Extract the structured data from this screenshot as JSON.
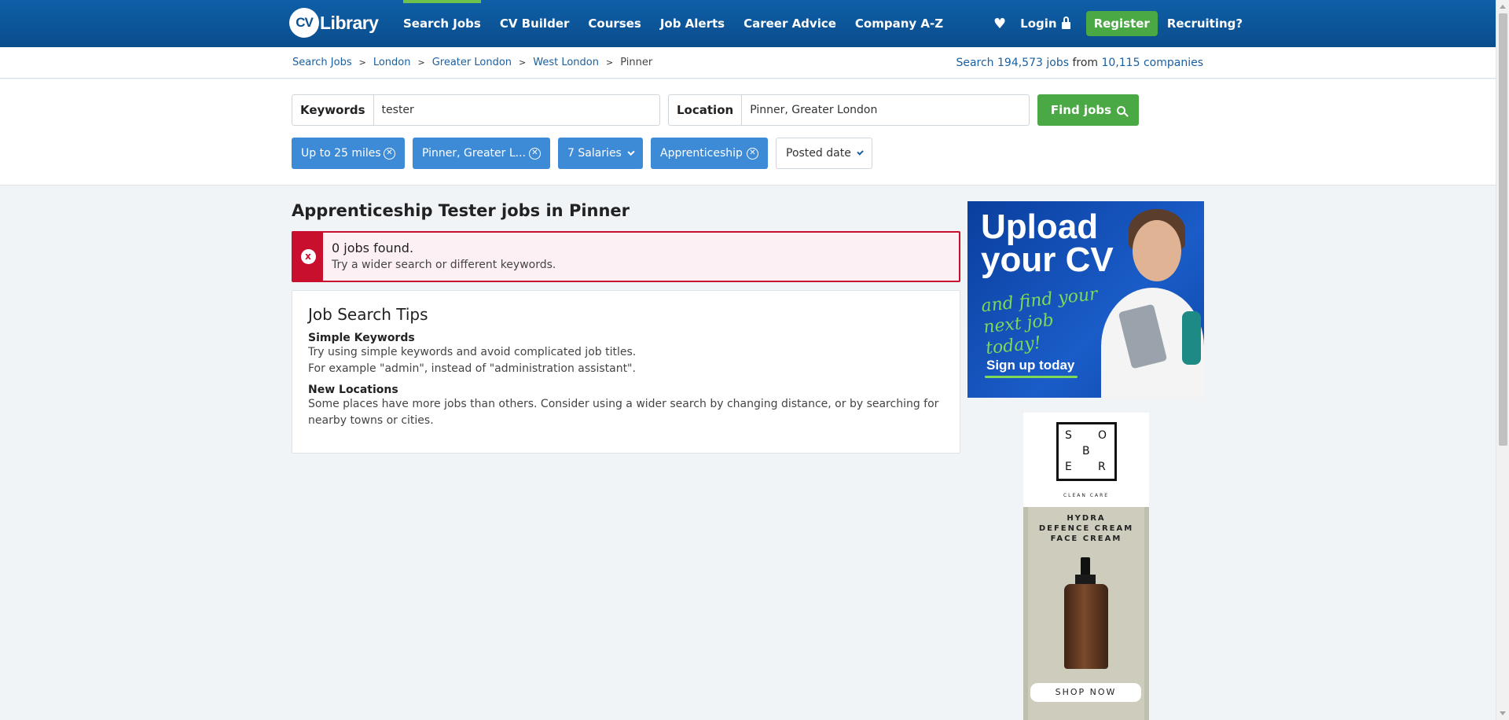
{
  "header": {
    "logo_cv": "CV",
    "logo_library": "Library",
    "nav": [
      {
        "label": "Search Jobs"
      },
      {
        "label": "CV Builder"
      },
      {
        "label": "Courses"
      },
      {
        "label": "Job Alerts"
      },
      {
        "label": "Career Advice"
      },
      {
        "label": "Company A-Z"
      }
    ],
    "login_label": "Login",
    "register_label": "Register",
    "recruiting_label": "Recruiting?"
  },
  "breadcrumb": {
    "items": [
      "Search Jobs",
      "London",
      "Greater London",
      "West London"
    ],
    "current": "Pinner",
    "separator": ">"
  },
  "stats": {
    "search_label": "Search",
    "jobs_count": "194,573",
    "jobs_label": "jobs",
    "from_label": "from",
    "companies_count": "10,115",
    "companies_label": "companies"
  },
  "search": {
    "keywords_label": "Keywords",
    "keywords_value": "tester",
    "location_label": "Location",
    "location_value": "Pinner, Greater London",
    "find_label": "Find jobs"
  },
  "filters": [
    {
      "label": "Up to 25 miles",
      "removable": true
    },
    {
      "label": "Pinner, Greater L...",
      "removable": true
    },
    {
      "label": "7 Salaries",
      "dropdown": true
    },
    {
      "label": "Apprenticeship",
      "removable": true
    },
    {
      "label": "Posted date",
      "dropdown": true
    }
  ],
  "main": {
    "title": "Apprenticeship Tester jobs in Pinner",
    "alert_title": "0 jobs found.",
    "alert_sub": "Try a wider search or different keywords.",
    "alert_icon": "x",
    "tips_title": "Job Search Tips",
    "tip1_heading": "Simple Keywords",
    "tip1_line1": "Try using simple keywords and avoid complicated job titles.",
    "tip1_line2": "For example \"admin\", instead of \"administration assistant\".",
    "tip2_heading": "New Locations",
    "tip2_text": "Some places have more jobs than others. Consider using a wider search by changing distance, or by searching for nearby towns or cities."
  },
  "ads": {
    "ad1_headline_1": "Upload",
    "ad1_headline_2": "your CV",
    "ad1_sub": "and find your next job today!",
    "ad1_cta": "Sign up today",
    "ad2_letters": [
      "S",
      "O",
      "B",
      "E",
      "R"
    ],
    "ad2_tag": "CLEAN CARE",
    "ad2_product_1": "HYDRA",
    "ad2_product_2": "DEFENCE CREAM",
    "ad2_product_3": "FACE CREAM",
    "ad2_cta": "SHOP NOW"
  },
  "colors": {
    "header_blue": "#0b4f91",
    "accent_green": "#4ba945",
    "chip_blue": "#3d8ad6",
    "link_blue": "#1a5f9e",
    "alert_red": "#c8102e",
    "alert_bg": "#fdf0f4"
  }
}
